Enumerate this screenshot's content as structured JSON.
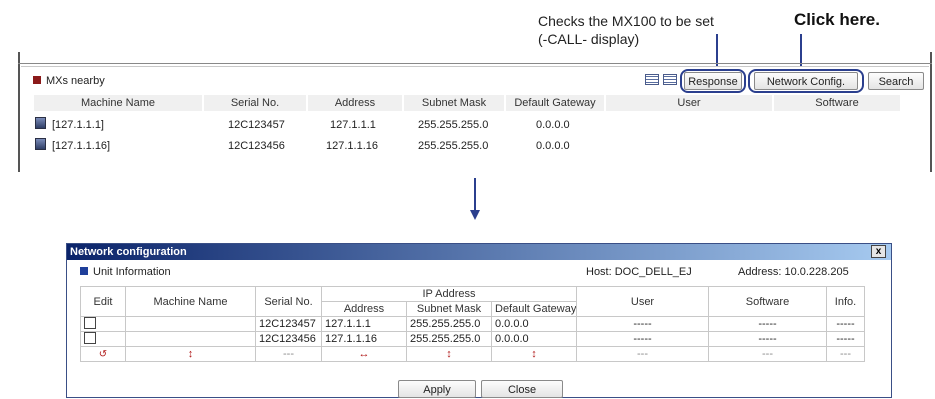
{
  "annotations": {
    "note_line1": "Checks the MX100 to be set",
    "note_line2": "(-CALL- display)",
    "click_here": "Click here."
  },
  "top_panel": {
    "section_title": "MXs nearby",
    "buttons": {
      "response": "Response",
      "network_config": "Network Config.",
      "search": "Search"
    },
    "columns": [
      "Machine Name",
      "Serial No.",
      "Address",
      "Subnet Mask",
      "Default Gateway",
      "User",
      "Software"
    ],
    "rows": [
      {
        "machine_name": "[127.1.1.1]",
        "serial": "12C123457",
        "address": "127.1.1.1",
        "subnet": "255.255.255.0",
        "gateway": "0.0.0.0"
      },
      {
        "machine_name": "[127.1.1.16]",
        "serial": "12C123456",
        "address": "127.1.1.16",
        "subnet": "255.255.255.0",
        "gateway": "0.0.0.0"
      }
    ]
  },
  "dialog": {
    "title": "Network configuration",
    "close_glyph": "x",
    "section_title": "Unit Information",
    "host": "Host: DOC_DELL_EJ",
    "address": "Address: 10.0.228.205",
    "headers": {
      "edit": "Edit",
      "machine_name": "Machine Name",
      "serial": "Serial No.",
      "ip_address": "IP Address",
      "address": "Address",
      "subnet": "Subnet Mask",
      "gateway": "Default Gateway",
      "user": "User",
      "software": "Software",
      "info": "Info."
    },
    "rows": [
      {
        "serial": "12C123457",
        "address": "127.1.1.1",
        "subnet": "255.255.255.0",
        "gateway": "0.0.0.0",
        "user": "-----",
        "software": "-----",
        "info": "-----"
      },
      {
        "serial": "12C123456",
        "address": "127.1.1.16",
        "subnet": "255.255.255.0",
        "gateway": "0.0.0.0",
        "user": "-----",
        "software": "-----",
        "info": "-----"
      }
    ],
    "indicator_row": {
      "edit": "↺",
      "machine_name": "↕",
      "serial": "---",
      "address": "↔",
      "subnet": "↕",
      "gateway": "↕",
      "user": "---",
      "software": "---",
      "info": "---"
    },
    "buttons": {
      "apply": "Apply",
      "close": "Close"
    }
  },
  "colors": {
    "accent": "#2b3f8e",
    "title_gradient_start": "#0b246a",
    "title_gradient_end": "#a6caf0",
    "marker_red": "#8b1a1a",
    "marker_blue": "#1f3f9a"
  }
}
